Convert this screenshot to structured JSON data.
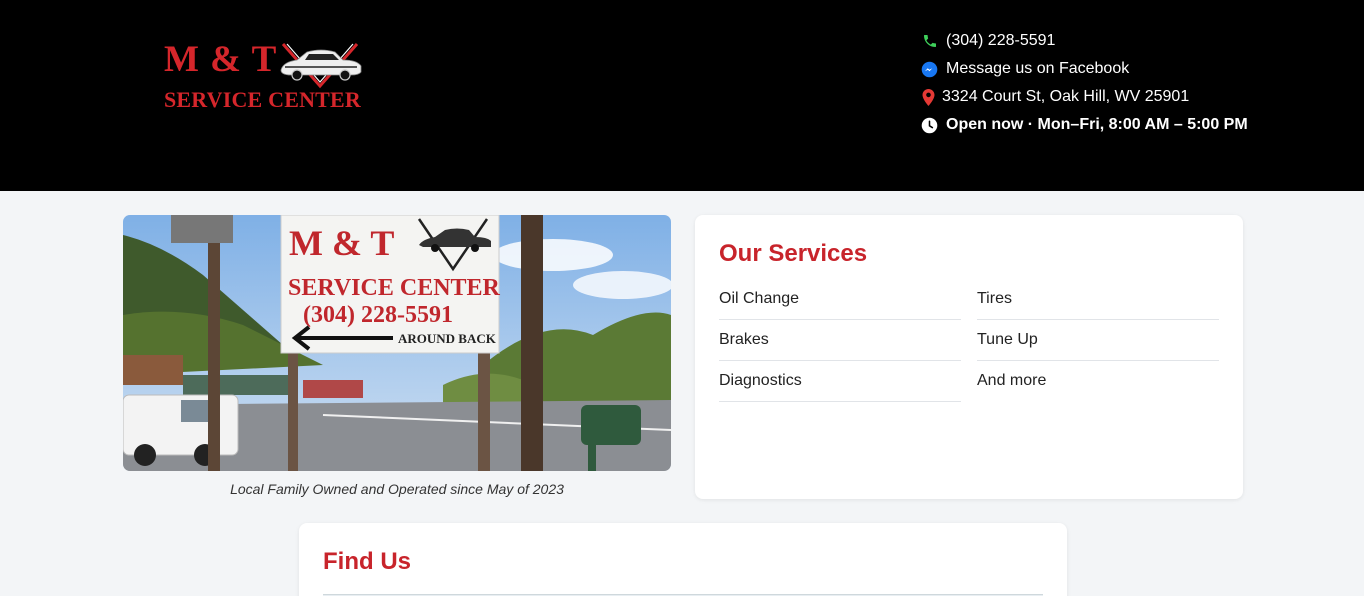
{
  "header": {
    "logo": {
      "line1": "M & T",
      "line2": "SERVICE CENTER"
    },
    "contact": {
      "phone": "(304) 228-5591",
      "messenger": "Message us on Facebook",
      "address": "3324 Court St, Oak Hill, WV 25901",
      "hours": "Open now · Mon–Fri, 8:00 AM – 5:00 PM"
    },
    "icons": {
      "phone": "phone-icon",
      "messenger": "messenger-icon",
      "address": "map-pin-icon",
      "hours": "clock-icon"
    },
    "colors": {
      "brand_red": "#d5262b",
      "phone_green": "#3ecf5a",
      "messenger_blue": "#1877f2",
      "pin_red": "#e53935"
    }
  },
  "hero": {
    "sign_line1": "M & T",
    "sign_line2": "SERVICE CENTER",
    "sign_phone": "(304) 228-5591",
    "sign_direction": "AROUND BACK",
    "caption": "Local Family Owned and Operated since May of 2023"
  },
  "services": {
    "title": "Our Services",
    "items": [
      "Oil Change",
      "Tires",
      "Brakes",
      "Tune Up",
      "Diagnostics",
      "And more"
    ]
  },
  "find_us": {
    "title": "Find Us"
  }
}
